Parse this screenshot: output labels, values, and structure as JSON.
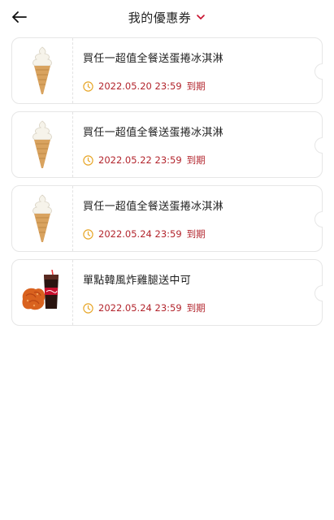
{
  "header": {
    "title": "我的優惠券",
    "back_icon": "arrow-left-icon",
    "dropdown_icon": "chevron-down-icon",
    "accent_color": "#c8102e"
  },
  "coupons": [
    {
      "name": "買任一超值全餐送蛋捲冰淇淋",
      "expiry": "2022.05.20 23:59",
      "expiry_suffix": "到期",
      "image": "soft-serve-cone"
    },
    {
      "name": "買任一超值全餐送蛋捲冰淇淋",
      "expiry": "2022.05.22 23:59",
      "expiry_suffix": "到期",
      "image": "soft-serve-cone"
    },
    {
      "name": "買任一超值全餐送蛋捲冰淇淋",
      "expiry": "2022.05.24 23:59",
      "expiry_suffix": "到期",
      "image": "soft-serve-cone"
    },
    {
      "name": "單點韓風炸雞腿送中可",
      "expiry": "2022.05.24 23:59",
      "expiry_suffix": "到期",
      "image": "fried-chicken-and-cola"
    }
  ],
  "colors": {
    "expiry_text": "#b3262e",
    "clock_icon": "#e8a72a",
    "card_border": "#e6e6e6"
  }
}
